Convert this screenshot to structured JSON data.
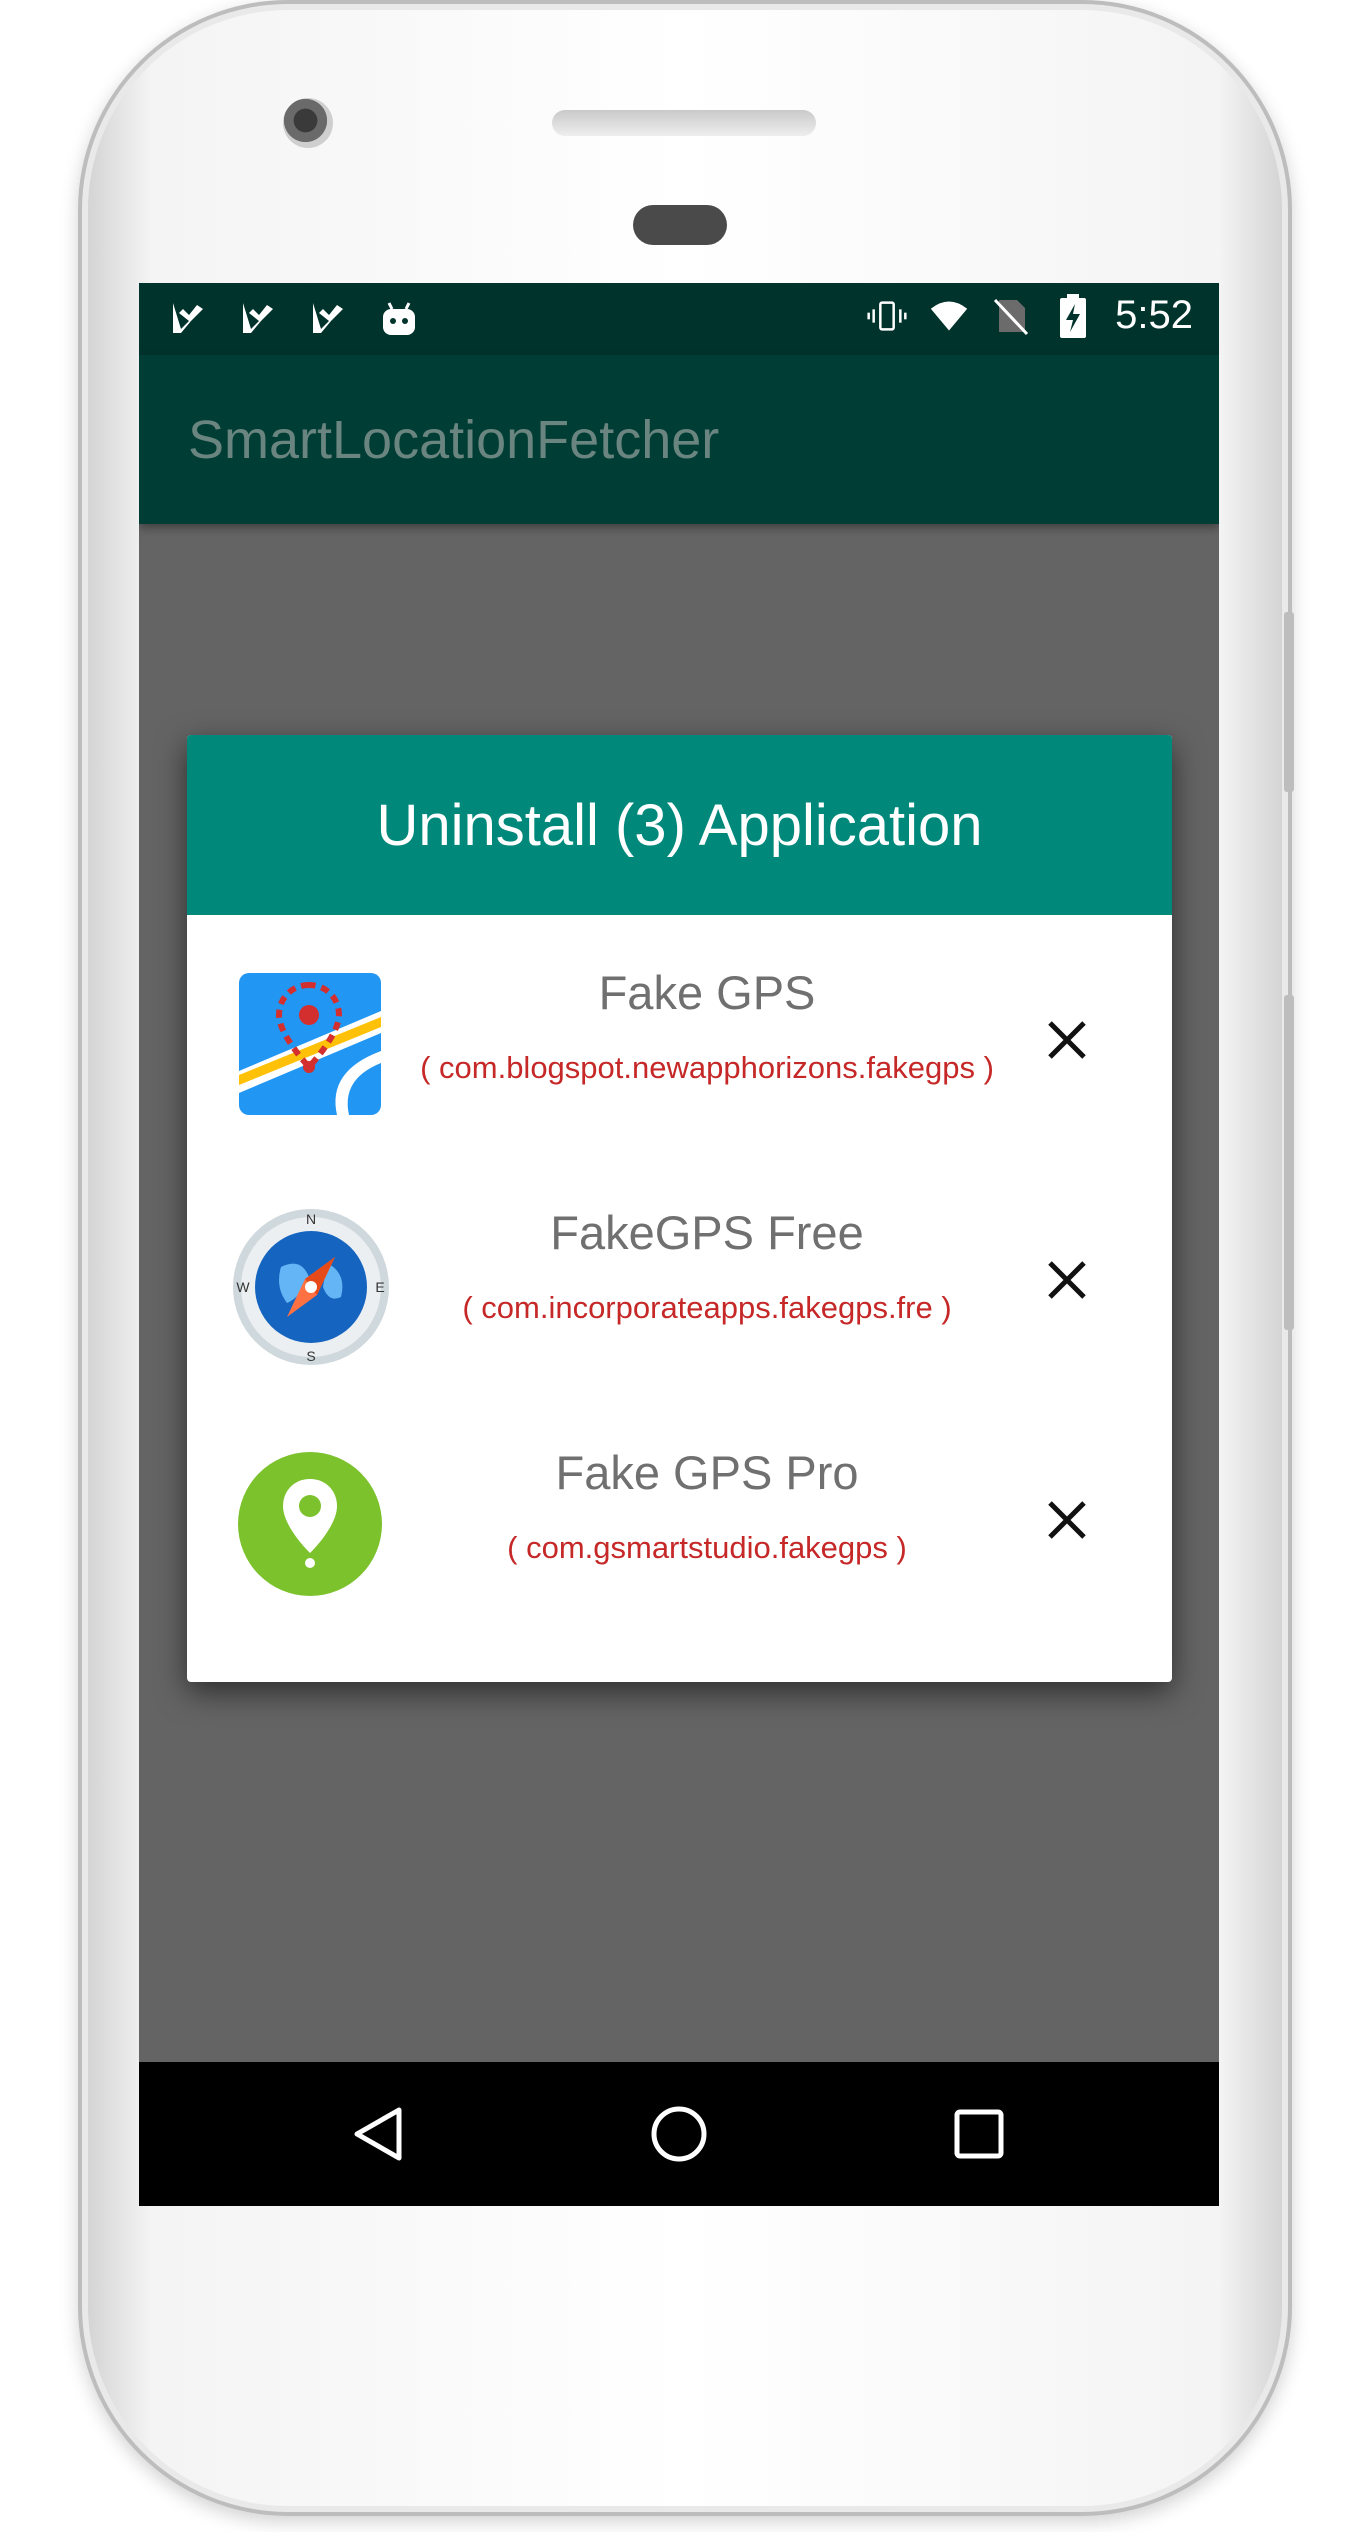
{
  "status_bar": {
    "time": "5:52",
    "left_icons": [
      "check-notification-icon",
      "check-notification-icon",
      "check-notification-icon",
      "android-icon"
    ],
    "right_icons": [
      "vibrate-icon",
      "wifi-icon",
      "no-sim-icon",
      "battery-charging-icon"
    ]
  },
  "app_bar": {
    "title": "SmartLocationFetcher"
  },
  "dialog": {
    "title": "Uninstall (3) Application",
    "apps": [
      {
        "name": "Fake GPS",
        "package": "( com.blogspot.newapphorizons.fakegps )",
        "icon": "fake-gps-map-icon"
      },
      {
        "name": "FakeGPS Free",
        "package": "( com.incorporateapps.fakegps.fre )",
        "icon": "compass-globe-icon"
      },
      {
        "name": "Fake GPS Pro",
        "package": "( com.gsmartstudio.fakegps )",
        "icon": "green-location-pin-icon"
      }
    ]
  },
  "nav_bar": {
    "buttons": [
      "back",
      "home",
      "recents"
    ]
  },
  "colors": {
    "status_bar": "#00332c",
    "app_bar": "#003d34",
    "dialog_header": "#00897b",
    "package_text": "#c62828",
    "scrim": "#646464"
  }
}
